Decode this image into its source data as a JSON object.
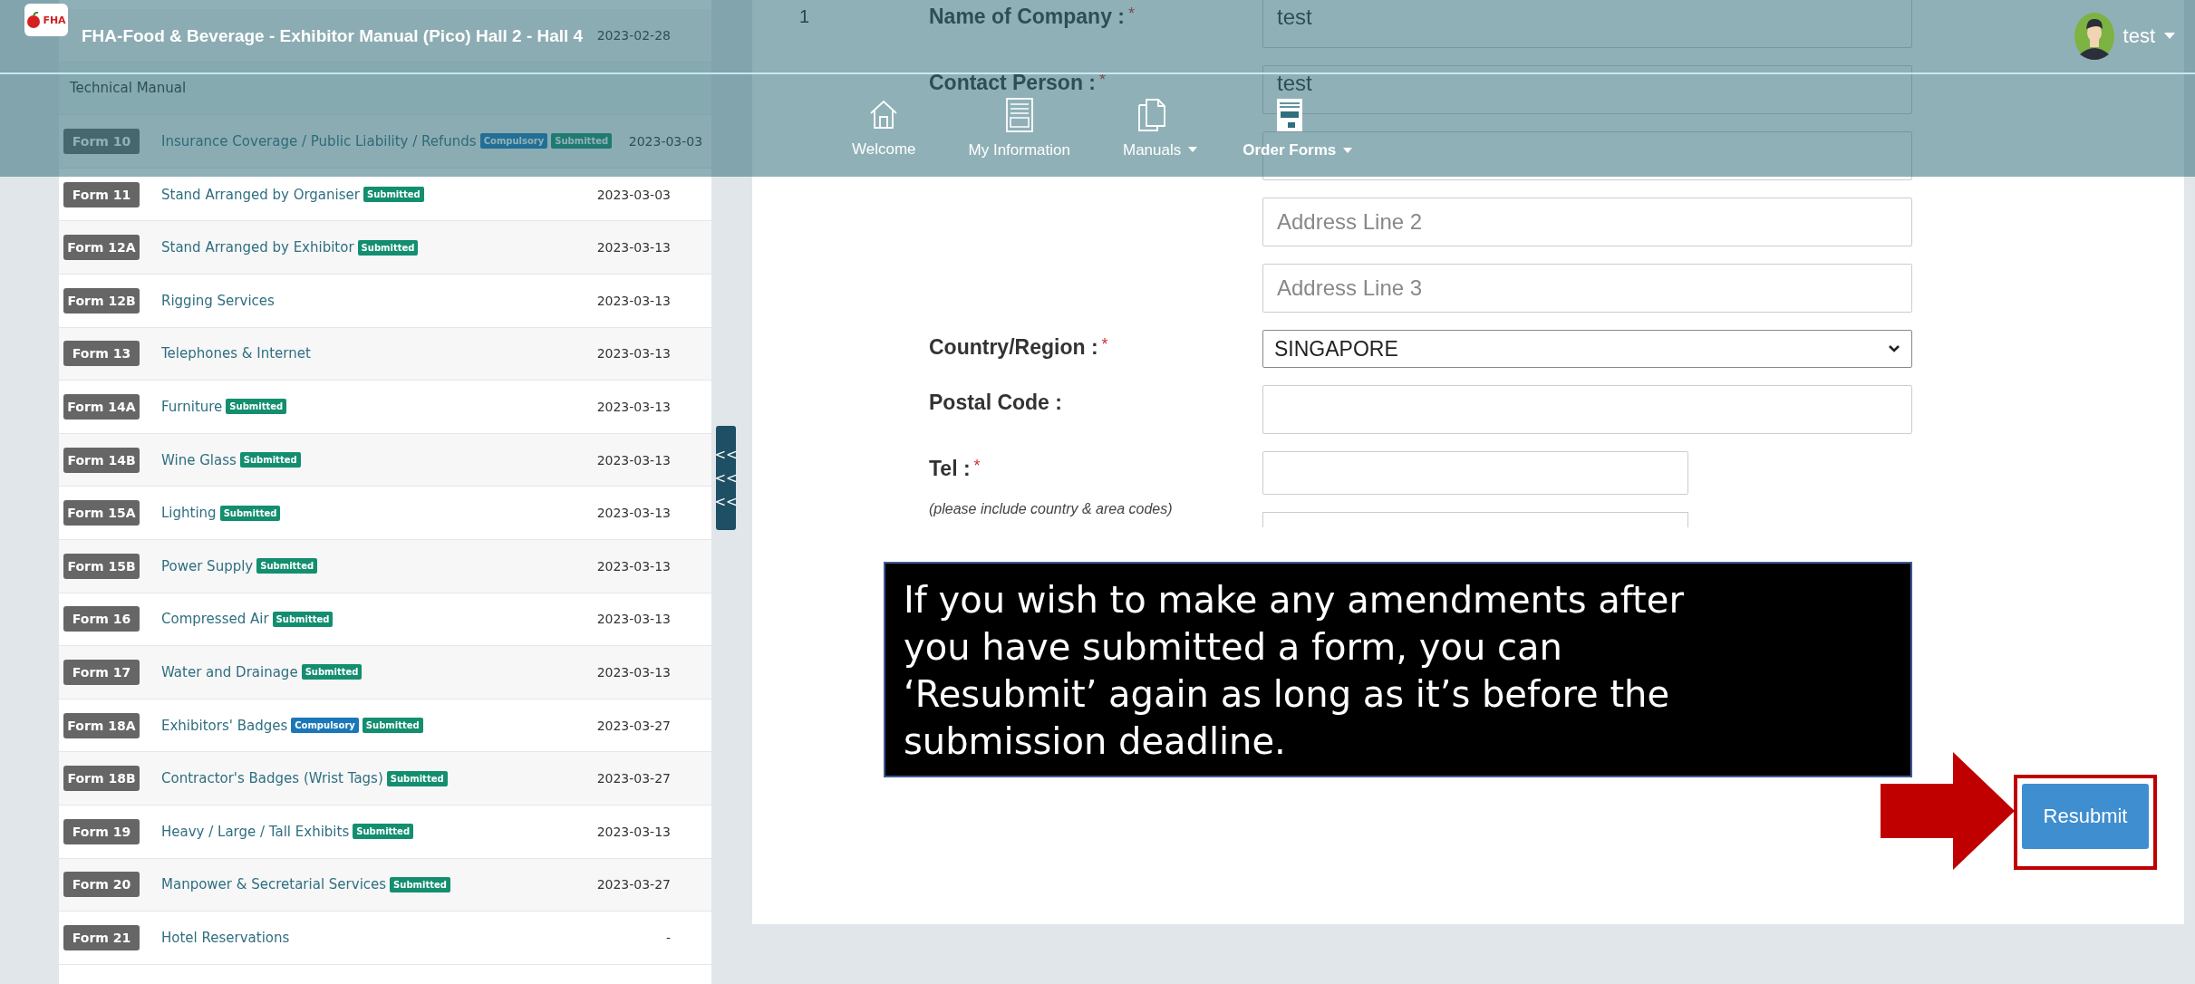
{
  "header": {
    "logo_text": "FHA",
    "title": "FHA-Food & Beverage - Exhibitor Manual (Pico) Hall 2 - Hall 4",
    "user": {
      "name": "test"
    },
    "nav": [
      {
        "label": "Welcome",
        "kind": "home",
        "dropdown": false,
        "selected": false
      },
      {
        "label": "My Information",
        "kind": "profile",
        "dropdown": false,
        "selected": false
      },
      {
        "label": "Manuals",
        "kind": "documents",
        "dropdown": true,
        "selected": false
      },
      {
        "label": "Order Forms",
        "kind": "form",
        "dropdown": true,
        "selected": true
      }
    ]
  },
  "forms_list": {
    "rows": [
      {
        "kind": "form",
        "title": "",
        "tags": [],
        "date": "2023-02-28"
      },
      {
        "kind": "section",
        "title": "Technical Manual"
      },
      {
        "kind": "form",
        "code": "Form 10",
        "title": "Insurance Coverage / Public Liability / Refunds",
        "tags": [
          {
            "kind": "compulsory",
            "label": "Compulsory"
          },
          {
            "kind": "submitted",
            "label": "Submitted"
          }
        ],
        "date": "2023-03-03"
      },
      {
        "kind": "form",
        "code": "Form 11",
        "title": "Stand Arranged by Organiser",
        "tags": [
          {
            "kind": "submitted",
            "label": "Submitted"
          }
        ],
        "date": "2023-03-03"
      },
      {
        "kind": "form",
        "code": "Form 12A",
        "title": "Stand Arranged by Exhibitor",
        "tags": [
          {
            "kind": "submitted",
            "label": "Submitted"
          }
        ],
        "date": "2023-03-13"
      },
      {
        "kind": "form",
        "code": "Form 12B",
        "title": "Rigging Services",
        "tags": [],
        "date": "2023-03-13"
      },
      {
        "kind": "form",
        "code": "Form 13",
        "title": "Telephones & Internet",
        "tags": [],
        "date": "2023-03-13"
      },
      {
        "kind": "form",
        "code": "Form 14A",
        "title": "Furniture",
        "tags": [
          {
            "kind": "submitted",
            "label": "Submitted"
          }
        ],
        "date": "2023-03-13"
      },
      {
        "kind": "form",
        "code": "Form 14B",
        "title": "Wine Glass",
        "tags": [
          {
            "kind": "submitted",
            "label": "Submitted"
          }
        ],
        "date": "2023-03-13"
      },
      {
        "kind": "form",
        "code": "Form 15A",
        "title": "Lighting",
        "tags": [
          {
            "kind": "submitted",
            "label": "Submitted"
          }
        ],
        "date": "2023-03-13"
      },
      {
        "kind": "form",
        "code": "Form 15B",
        "title": "Power Supply",
        "tags": [
          {
            "kind": "submitted",
            "label": "Submitted"
          }
        ],
        "date": "2023-03-13"
      },
      {
        "kind": "form",
        "code": "Form 16",
        "title": "Compressed Air",
        "tags": [
          {
            "kind": "submitted",
            "label": "Submitted"
          }
        ],
        "date": "2023-03-13"
      },
      {
        "kind": "form",
        "code": "Form 17",
        "title": "Water and Drainage",
        "tags": [
          {
            "kind": "submitted",
            "label": "Submitted"
          }
        ],
        "date": "2023-03-13"
      },
      {
        "kind": "form",
        "code": "Form 18A",
        "title": "Exhibitors' Badges",
        "tags": [
          {
            "kind": "compulsory",
            "label": "Compulsory"
          },
          {
            "kind": "submitted",
            "label": "Submitted"
          }
        ],
        "date": "2023-03-27"
      },
      {
        "kind": "form",
        "code": "Form 18B",
        "title": "Contractor's Badges (Wrist Tags)",
        "tags": [
          {
            "kind": "submitted",
            "label": "Submitted"
          }
        ],
        "date": "2023-03-27"
      },
      {
        "kind": "form",
        "code": "Form 19",
        "title": "Heavy / Large / Tall Exhibits",
        "tags": [
          {
            "kind": "submitted",
            "label": "Submitted"
          }
        ],
        "date": "2023-03-13"
      },
      {
        "kind": "form",
        "code": "Form 20",
        "title": "Manpower & Secretarial Services",
        "tags": [
          {
            "kind": "submitted",
            "label": "Submitted"
          }
        ],
        "date": "2023-03-27"
      },
      {
        "kind": "form",
        "code": "Form 21",
        "title": "Hotel Reservations",
        "tags": [],
        "date": "-"
      }
    ]
  },
  "collapse_tab": {
    "glyphs": [
      "<<",
      "<<",
      "<<"
    ]
  },
  "form": {
    "row_number": "1",
    "fields": [
      {
        "kind": "text",
        "label": "Name of Company :",
        "required_mark": "*",
        "value": "test"
      },
      {
        "kind": "text",
        "label": "Contact Person :",
        "required_mark": "*",
        "value": "test"
      },
      {
        "kind": "text"
      },
      {
        "kind": "text",
        "placeholder": "Address Line 2"
      },
      {
        "kind": "text",
        "placeholder": "Address Line 3"
      },
      {
        "kind": "select",
        "label": "Country/Region :",
        "required_mark": "*",
        "value": "SINGAPORE"
      },
      {
        "kind": "text",
        "label": "Postal Code :"
      },
      {
        "kind": "short",
        "label": "Tel :",
        "required_mark": "*",
        "hint": "(please include country & area codes)"
      },
      {
        "kind": "stub"
      }
    ]
  },
  "callout": {
    "text": "If you wish to make any amendments after you have submitted a form, you can ‘Resubmit’ again as long as it’s before the submission deadline."
  },
  "resubmit_button": {
    "label": "Resubmit"
  }
}
